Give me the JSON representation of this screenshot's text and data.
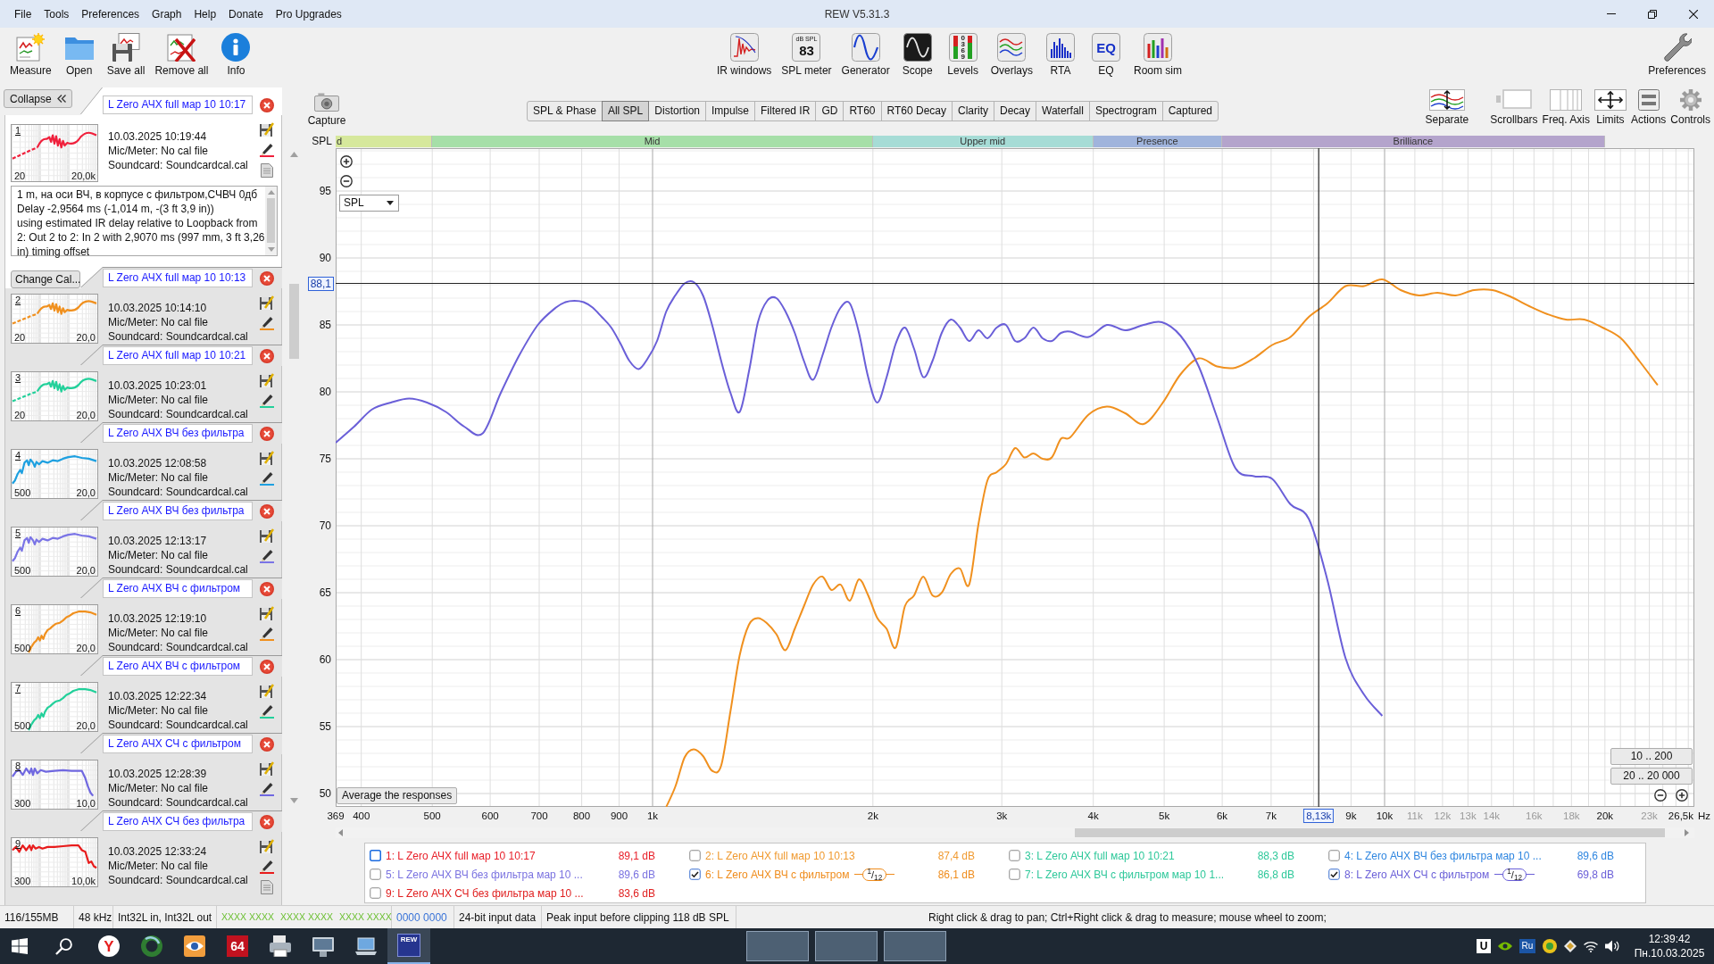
{
  "window": {
    "title": "REW V5.31.3"
  },
  "menu": [
    "File",
    "Tools",
    "Preferences",
    "Graph",
    "Help",
    "Donate",
    "Pro Upgrades"
  ],
  "toolbar": {
    "left": [
      {
        "label": "Measure"
      },
      {
        "label": "Open"
      },
      {
        "label": "Save all"
      },
      {
        "label": "Remove all"
      },
      {
        "label": "Info"
      }
    ],
    "center": [
      {
        "label": "IR windows"
      },
      {
        "label": "SPL meter",
        "unit": "dB SPL",
        "reading": "83"
      },
      {
        "label": "Generator"
      },
      {
        "label": "Scope"
      },
      {
        "label": "Levels",
        "scale": "0369"
      },
      {
        "label": "Overlays"
      },
      {
        "label": "RTA"
      },
      {
        "label": "EQ",
        "badge": "EQ"
      },
      {
        "label": "Room sim"
      }
    ],
    "right": [
      {
        "label": "Preferences"
      }
    ]
  },
  "panel": {
    "collapse_button": "Collapse",
    "entries": [
      {
        "name": "L Zero АЧХ full мар 10 10:17",
        "number": "1",
        "date": "10.03.2025 10:19:44",
        "mic": "Mic/Meter: No cal file",
        "soundcard": "Soundcard: Soundcardcal.cal",
        "axis_min": "20",
        "axis_max": "20,0k",
        "color": "#f0203c",
        "kind": "wide",
        "selected": true,
        "notes": "1 m, на оси ВЧ, в корпусе с фильтром,СЧВЧ 0дб\nDelay -2,9564 ms (-1,014 m, -(3 ft 3,9 in))\nusing estimated IR delay relative to Loopback from\n2: Out 2 to 2: In 2 with 2,9070 ms (997 mm, 3 ft 3,26\nin) timing offset",
        "calibration_button": "Change Cal..."
      },
      {
        "name": "L Zero АЧХ full мар 10 10:13",
        "number": "2",
        "date": "10.03.2025 10:14:10",
        "mic": "Mic/Meter: No cal file",
        "soundcard": "Soundcard: Soundcardcal.cal",
        "axis_min": "20",
        "axis_max": "20,0",
        "color": "#f0901e",
        "kind": "wide",
        "selected": false
      },
      {
        "name": "L Zero АЧХ full мар 10 10:21",
        "number": "3",
        "date": "10.03.2025 10:23:01",
        "mic": "Mic/Meter: No cal file",
        "soundcard": "Soundcard: Soundcardcal.cal",
        "axis_min": "20",
        "axis_max": "20,0",
        "color": "#22d09a",
        "kind": "wide",
        "selected": false
      },
      {
        "name": "L Zero АЧХ ВЧ без фильтра",
        "number": "4",
        "date": "10.03.2025 12:08:58",
        "mic": "Mic/Meter: No cal file",
        "soundcard": "Soundcard: Soundcardcal.cal",
        "axis_min": "500",
        "axis_max": "20,0",
        "color": "#1ea0e0",
        "kind": "rising",
        "selected": false
      },
      {
        "name": "L Zero АЧХ ВЧ без фильтра",
        "number": "5",
        "date": "10.03.2025 12:13:17",
        "mic": "Mic/Meter: No cal file",
        "soundcard": "Soundcard: Soundcardcal.cal",
        "axis_min": "500",
        "axis_max": "20,0",
        "color": "#7a74e6",
        "kind": "rising",
        "selected": false
      },
      {
        "name": "L Zero АЧХ ВЧ с фильтром",
        "number": "6",
        "date": "10.03.2025 12:19:10",
        "mic": "Mic/Meter: No cal file",
        "soundcard": "Soundcard: Soundcardcal.cal",
        "axis_min": "500",
        "axis_max": "20,0",
        "color": "#f0901e",
        "kind": "steep",
        "selected": false
      },
      {
        "name": "L Zero АЧХ ВЧ с фильтром",
        "number": "7",
        "date": "10.03.2025 12:22:34",
        "mic": "Mic/Meter: No cal file",
        "soundcard": "Soundcard: Soundcardcal.cal",
        "axis_min": "500",
        "axis_max": "20,0",
        "color": "#22d09a",
        "kind": "steep",
        "selected": false
      },
      {
        "name": "L Zero АЧХ СЧ с фильтром",
        "number": "8",
        "date": "10.03.2025 12:28:39",
        "mic": "Mic/Meter: No cal file",
        "soundcard": "Soundcard: Soundcardcal.cal",
        "axis_min": "300",
        "axis_max": "10,0",
        "color": "#7068e0",
        "kind": "cutoff",
        "selected": false
      },
      {
        "name": "L Zero АЧХ СЧ без фильтра",
        "number": "9",
        "date": "10.03.2025 12:33:24",
        "mic": "Mic/Meter: No cal file",
        "soundcard": "Soundcard: Soundcardcal.cal",
        "axis_min": "300",
        "axis_max": "10,0k",
        "color": "#e81c1c",
        "kind": "falling",
        "selected": false
      }
    ]
  },
  "graph_header": {
    "capture": "Capture",
    "tabs": [
      {
        "label": "SPL & Phase",
        "selected": false
      },
      {
        "label": "All SPL",
        "selected": true
      },
      {
        "label": "Distortion",
        "selected": false
      },
      {
        "label": "Impulse",
        "selected": false
      },
      {
        "label": "Filtered IR",
        "selected": false
      },
      {
        "label": "GD",
        "selected": false
      },
      {
        "label": "RT60",
        "selected": false
      },
      {
        "label": "RT60 Decay",
        "selected": false
      },
      {
        "label": "Clarity",
        "selected": false
      },
      {
        "label": "Decay",
        "selected": false
      },
      {
        "label": "Waterfall",
        "selected": false
      },
      {
        "label": "Spectrogram",
        "selected": false
      },
      {
        "label": "Captured",
        "selected": false
      }
    ],
    "tools": [
      "Separate",
      "Scrollbars",
      "Freq. Axis",
      "Limits",
      "Actions",
      "Controls"
    ]
  },
  "chart": {
    "bands": [
      {
        "label": "d",
        "color": "#d6e89c"
      },
      {
        "label": "Mid",
        "color": "#a6dfa8"
      },
      {
        "label": "Upper mid",
        "color": "#a6dcd6"
      },
      {
        "label": "Presence",
        "color": "#a0b4dc"
      },
      {
        "label": "Brilliance",
        "color": "#b4a4cc"
      }
    ],
    "view_selector": "SPL",
    "average_button": "Average the responses",
    "range_buttons": [
      "10 .. 200",
      "20 .. 20 000"
    ],
    "chart_data": {
      "type": "line",
      "log": "x",
      "grid": true,
      "xlabel": "Hz",
      "ylabel": "SPL",
      "xlim": [
        369,
        26500
      ],
      "ylim": [
        49,
        98.2
      ],
      "xticks": [
        {
          "value": 369,
          "label": "369"
        },
        400,
        500,
        600,
        700,
        800,
        900,
        {
          "value": 1000,
          "label": "1k"
        },
        {
          "value": 2000,
          "label": "2k"
        },
        {
          "value": 3000,
          "label": "3k"
        },
        {
          "value": 4000,
          "label": "4k"
        },
        {
          "value": 5000,
          "label": "5k"
        },
        {
          "value": 6000,
          "label": "6k"
        },
        {
          "value": 7000,
          "label": "7k"
        },
        {
          "value": 9000,
          "label": "9k"
        },
        {
          "value": 10000,
          "label": "10k"
        },
        {
          "value": 11000,
          "label": "11k"
        },
        {
          "value": 12000,
          "label": "12k"
        },
        {
          "value": 13000,
          "label": "13k"
        },
        {
          "value": 14000,
          "label": "14k"
        },
        {
          "value": 16000,
          "label": "16k"
        },
        {
          "value": 18000,
          "label": "18k"
        },
        {
          "value": 20000,
          "label": "20k"
        },
        {
          "value": 23000,
          "label": "23k"
        },
        {
          "value": 26500,
          "label": "26,5k"
        }
      ],
      "yticks": [
        50,
        55,
        60,
        65,
        70,
        75,
        80,
        85,
        90,
        95
      ],
      "x": [
        369,
        391,
        414,
        439,
        465,
        492,
        522,
        553,
        586,
        620,
        657,
        697,
        738,
        760,
        782,
        805,
        828,
        852,
        878,
        904,
        930,
        957,
        985,
        1014,
        1044,
        1074,
        1106,
        1138,
        1172,
        1206,
        1241,
        1278,
        1315,
        1354,
        1393,
        1434,
        1476,
        1519,
        1564,
        1610,
        1657,
        1706,
        1755,
        1807,
        1860,
        1914,
        1970,
        2028,
        2088,
        2149,
        2212,
        2277,
        2343,
        2412,
        2483,
        2555,
        2630,
        2707,
        2787,
        2868,
        2952,
        3039,
        3128,
        3220,
        3314,
        3411,
        3511,
        3614,
        3720,
        3941,
        4175,
        4423,
        4687,
        4965,
        5261,
        5573,
        5904,
        6255,
        6627,
        7022,
        7439,
        7881,
        8350,
        8846,
        9372,
        9929,
        10520,
        11145,
        11808,
        12510,
        13253,
        14041,
        14876,
        15761,
        16698,
        17691,
        18743,
        19857,
        21038,
        22289,
        23614
      ],
      "series": [
        {
          "color": "#f0901e",
          "values": [
            null,
            null,
            null,
            null,
            null,
            null,
            null,
            null,
            null,
            null,
            null,
            null,
            null,
            null,
            null,
            null,
            null,
            null,
            null,
            null,
            null,
            null,
            null,
            null,
            49.0,
            50.5,
            52.7,
            53.3,
            52.8,
            51.7,
            52.1,
            56.2,
            60.3,
            62.6,
            63.1,
            62.7,
            61.9,
            60.7,
            62.3,
            64.0,
            65.6,
            66.2,
            65.2,
            65.6,
            64.4,
            66.0,
            64.8,
            63.1,
            62.3,
            60.9,
            64.0,
            64.8,
            66.2,
            64.8,
            65.0,
            66.4,
            66.8,
            65.6,
            70.1,
            73.4,
            74.0,
            74.6,
            75.8,
            75.1,
            75.4,
            75.0,
            75.1,
            76.5,
            76.6,
            78.3,
            78.9,
            78.4,
            77.6,
            79.1,
            81.3,
            82.5,
            81.9,
            81.8,
            82.5,
            83.5,
            84.1,
            85.6,
            86.6,
            87.9,
            87.9,
            88.4,
            87.6,
            87.2,
            87.4,
            87.2,
            87.6,
            87.6,
            87.1,
            86.4,
            85.8,
            85.4,
            85.4,
            84.8,
            84.0,
            82.3,
            80.5
          ]
        },
        {
          "color": "#6a5fd8",
          "values": [
            76.2,
            77.4,
            78.7,
            79.2,
            79.5,
            79.2,
            78.5,
            77.4,
            76.9,
            79.9,
            82.7,
            85.0,
            86.3,
            86.7,
            86.8,
            86.7,
            86.3,
            85.6,
            84.8,
            83.6,
            82.3,
            81.7,
            82.5,
            83.8,
            86.0,
            87.2,
            88.1,
            88.2,
            87.2,
            85.0,
            82.3,
            79.9,
            78.5,
            81.5,
            85.2,
            86.8,
            87.0,
            86.0,
            84.4,
            82.3,
            80.9,
            82.7,
            84.8,
            86.3,
            86.6,
            84.4,
            81.1,
            79.2,
            81.1,
            83.6,
            84.8,
            83.2,
            81.1,
            82.3,
            84.4,
            85.4,
            84.8,
            83.8,
            84.6,
            84.0,
            84.8,
            85.0,
            83.8,
            84.0,
            84.8,
            84.0,
            83.8,
            84.4,
            84.5,
            84.1,
            85.0,
            84.6,
            85.0,
            85.2,
            84.2,
            81.9,
            78.1,
            74.3,
            73.7,
            73.5,
            71.6,
            70.5,
            66.0,
            60.1,
            57.4,
            55.8,
            null,
            null,
            null,
            null,
            null,
            null,
            null,
            null,
            null,
            null,
            null,
            null,
            null,
            null,
            null
          ]
        }
      ],
      "ref_lines": [
        {
          "axis": "x",
          "value": 8130,
          "label": "8,13k"
        },
        {
          "axis": "y",
          "value": 88.1,
          "label": "88,1"
        }
      ]
    }
  },
  "legend": [
    {
      "label": "1: L Zero АЧХ full мар 10 10:17",
      "reading": "89,1 dB",
      "color": "#e8202a",
      "checked": false,
      "focused": true
    },
    {
      "label": "2: L Zero АЧХ full мар 10 10:13",
      "reading": "87,4 dB",
      "color": "#f09a30",
      "checked": false,
      "focused": false
    },
    {
      "label": "3: L Zero АЧХ full мар 10 10:21",
      "reading": "88,3 dB",
      "color": "#2ec89a",
      "checked": false,
      "focused": false
    },
    {
      "label": "4: L Zero АЧХ ВЧ без фильтра мар 10 ...",
      "reading": "89,6 dB",
      "color": "#2f86e0",
      "checked": false,
      "focused": false
    },
    {
      "label": "5: L Zero АЧХ ВЧ без фильтра мар 10 ...",
      "reading": "89,6 dB",
      "color": "#7a72e0",
      "checked": false,
      "focused": false
    },
    {
      "label": "6: L Zero АЧХ ВЧ с фильтром",
      "reading": "86,1 dB",
      "color": "#ef8c1c",
      "checked": true,
      "focused": false,
      "smoothing": "$^{1}$/$_{12}$"
    },
    {
      "label": "7: L Zero АЧХ ВЧ с фильтром мар 10 1...",
      "reading": "86,8 dB",
      "color": "#2ec89a",
      "checked": false,
      "focused": false
    },
    {
      "label": "8: L Zero АЧХ СЧ с фильтром",
      "reading": "69,8 dB",
      "color": "#6a5fd8",
      "checked": true,
      "focused": false,
      "smoothing": "$^{1}$/$_{12}$"
    },
    {
      "label": "9: L Zero АЧХ СЧ без фильтра мар 10 ...",
      "reading": "83,6 dB",
      "color": "#e02020",
      "checked": false,
      "focused": false
    }
  ],
  "status_bar": {
    "memory": "116/155MB",
    "sample_rate": "48 kHz",
    "formats": "Int32L in, Int32L out",
    "input_levels": [
      "XXXX XXXX",
      "XXXX XXXX",
      "XXXX XXXX"
    ],
    "output_bits": "0000 0000",
    "input_depth": "24-bit input data",
    "peak": "Peak input before clipping 118 dB SPL",
    "hint": "Right click & drag to pan; Ctrl+Right click & drag to measure; mouse wheel to zoom;"
  },
  "taskbar": {
    "apps": [
      {
        "badge": "Y",
        "selected": false
      },
      {
        "selected": false
      },
      {
        "selected": false
      },
      {
        "badge": "64",
        "selected": false
      },
      {
        "selected": false
      },
      {
        "selected": false
      },
      {
        "selected": false
      },
      {
        "badge": "REW",
        "selected": true
      }
    ],
    "tray_badges": [
      "U",
      "Ru"
    ],
    "clock": {
      "time": "12:39:42",
      "date": "Пн.10.03.2025"
    }
  }
}
